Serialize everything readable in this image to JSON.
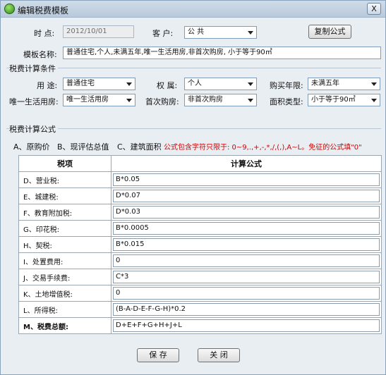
{
  "window": {
    "title": "编辑税费模板",
    "close_label": "X"
  },
  "header": {
    "time_label": "时 点:",
    "time_value": "2012/10/01",
    "customer_label": "客 户:",
    "customer_value": "公 共",
    "copy_button": "复制公式",
    "template_label": "模板名称:",
    "template_value": "普通住宅,个人,未满五年,唯一生活用房,非首次购房, 小于等于90㎡"
  },
  "conditions": {
    "title": "税费计算条件",
    "usage_label": "用 途:",
    "usage_value": "普通住宅",
    "ownership_label": "权 属:",
    "ownership_value": "个人",
    "years_label": "购买年限:",
    "years_value": "未满五年",
    "only_home_label": "唯一生活用房:",
    "only_home_value": "唯一生活用房",
    "first_buy_label": "首次购房:",
    "first_buy_value": "非首次购房",
    "area_label": "面积类型:",
    "area_value": "小于等于90㎡"
  },
  "formulas": {
    "title": "税费计算公式",
    "var_a": "A、原购价",
    "var_b": "B、现评估总值",
    "var_c": "C、建筑面积",
    "note": "公式包含字符只限于: 0~9,.,+,-,*,/,(,),A~L。免征的公式填\"0\"",
    "col_item": "税项",
    "col_formula": "计算公式",
    "rows": [
      {
        "name": "D、营业税:",
        "formula": "B*0.05"
      },
      {
        "name": "E、城建税:",
        "formula": "D*0.07"
      },
      {
        "name": "F、教育附加税:",
        "formula": "D*0.03"
      },
      {
        "name": "G、印花税:",
        "formula": "B*0.0005"
      },
      {
        "name": "H、契税:",
        "formula": "B*0.015"
      },
      {
        "name": "I、处置费用:",
        "formula": "0"
      },
      {
        "name": "J、交易手续费:",
        "formula": "C*3"
      },
      {
        "name": "K、土地增值税:",
        "formula": "0"
      },
      {
        "name": "L、所得税:",
        "formula": "(B-A-D-E-F-G-H)*0.2"
      },
      {
        "name": "M、税费总额:",
        "formula": "D+E+F+G+H+J+L"
      }
    ]
  },
  "footer": {
    "save": "保 存",
    "close": "关 闭"
  }
}
